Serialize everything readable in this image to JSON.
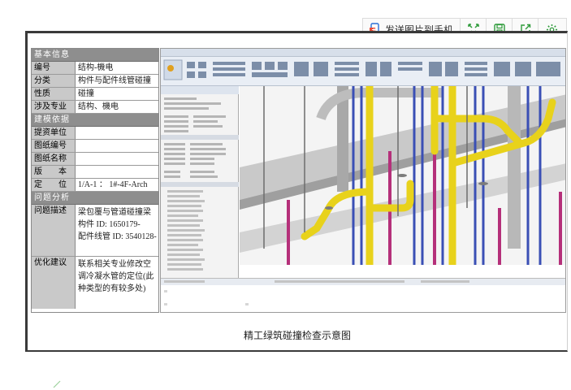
{
  "toolbar": {
    "send_label": "发送图片到手机",
    "icons": [
      "send-to-phone-icon",
      "fullscreen-icon",
      "save-icon",
      "share-icon",
      "settings-icon"
    ],
    "accent": "#2e9b3a"
  },
  "info_table": {
    "section_basic": "基本信息",
    "rows_basic": [
      {
        "key": "编号",
        "value": "结构-機电"
      },
      {
        "key": "分类",
        "value": "构件与配件线管碰撞"
      },
      {
        "key": "性质",
        "value": "碰撞"
      },
      {
        "key": "涉及专业",
        "value": "结构、機电"
      }
    ],
    "section_model": "建模依据",
    "rows_model": [
      {
        "key": "提资单位",
        "value": ""
      },
      {
        "key": "图纸编号",
        "value": ""
      },
      {
        "key": "图纸名称",
        "value": ""
      },
      {
        "key": "版　　本",
        "value": ""
      },
      {
        "key": "定　　位",
        "value": "1/A-1 ： 1#-4F-Arch"
      }
    ],
    "section_problem": "问题分析",
    "problem_key": "问题描述",
    "problem_lines": [
      "梁包覆与管道碰撞梁",
      "构件 ID: 1650179-",
      "配件线管 ID: 3540128-"
    ],
    "suggest_key": "优化建议",
    "suggest_lines": [
      "联系相关专业修改空",
      "调冷凝水管的定位(此",
      "种类型的有较多处)"
    ]
  },
  "caption": "精工绿筑碰撞检查示意图"
}
